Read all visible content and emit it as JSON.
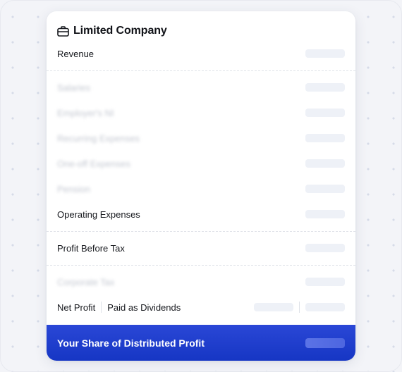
{
  "card": {
    "title": "Limited Company",
    "icon": "briefcase-icon",
    "rows": {
      "revenue": "Revenue",
      "salaries": "Salaries",
      "employers_ni": "Employer's NI",
      "recurring_expenses": "Recurring Expenses",
      "one_off_expenses": "One-off Expenses",
      "pension": "Pension",
      "operating_expenses": "Operating Expenses",
      "profit_before_tax": "Profit Before Tax",
      "corporate_tax": "Corporate Tax",
      "net_profit": "Net Profit",
      "paid_as_dividends": "Paid as Dividends"
    },
    "footer": {
      "label": "Your Share of Distributed Profit"
    }
  },
  "colors": {
    "accent": "#1f3fd0",
    "text": "#15171c",
    "placeholder": "#eef1f7"
  }
}
